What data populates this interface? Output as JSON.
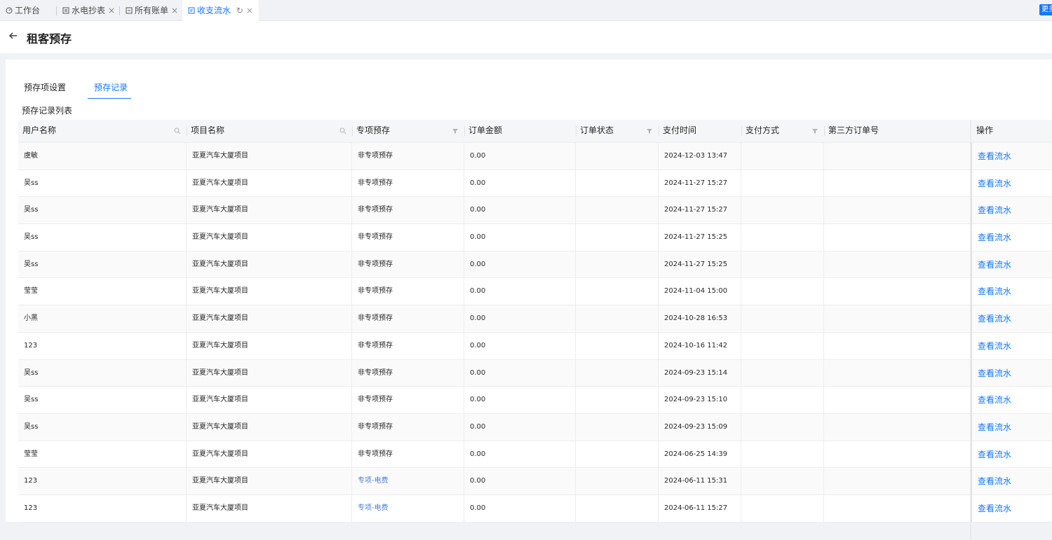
{
  "tabs": [
    {
      "icon": "dashboard-icon",
      "label": "工作台",
      "closable": false
    },
    {
      "icon": "meter-icon",
      "label": "水电抄表",
      "closable": true
    },
    {
      "icon": "bill-icon",
      "label": "所有账单",
      "closable": true
    },
    {
      "icon": "ledger-icon",
      "label": "收支流水",
      "closable": true,
      "active": true
    }
  ],
  "more_button": "更多",
  "page": {
    "title": "租客预存"
  },
  "subtabs": [
    "预存项设置",
    "预存记录"
  ],
  "active_subtab": "预存记录",
  "section_title": "预存记录列表",
  "table": {
    "headers": [
      "用户名称",
      "项目名称",
      "专项预存",
      "订单金额",
      "订单状态",
      "支付时间",
      "支付方式",
      "第三方订单号",
      "操作"
    ],
    "action_label": "查看流水",
    "rows": [
      {
        "user": "虞敏",
        "project": "亚夏汽车大厦项目",
        "type": "非专项预存",
        "amount": "0.00",
        "status": "",
        "time": "2024-12-03 13:47",
        "method": "",
        "order_no": ""
      },
      {
        "user": "吴ss",
        "project": "亚夏汽车大厦项目",
        "type": "非专项预存",
        "amount": "0.00",
        "status": "",
        "time": "2024-11-27 15:27",
        "method": "",
        "order_no": ""
      },
      {
        "user": "吴ss",
        "project": "亚夏汽车大厦项目",
        "type": "非专项预存",
        "amount": "0.00",
        "status": "",
        "time": "2024-11-27 15:27",
        "method": "",
        "order_no": ""
      },
      {
        "user": "吴ss",
        "project": "亚夏汽车大厦项目",
        "type": "非专项预存",
        "amount": "0.00",
        "status": "",
        "time": "2024-11-27 15:25",
        "method": "",
        "order_no": ""
      },
      {
        "user": "吴ss",
        "project": "亚夏汽车大厦项目",
        "type": "非专项预存",
        "amount": "0.00",
        "status": "",
        "time": "2024-11-27 15:25",
        "method": "",
        "order_no": ""
      },
      {
        "user": "莹莹",
        "project": "亚夏汽车大厦项目",
        "type": "非专项预存",
        "amount": "0.00",
        "status": "",
        "time": "2024-11-04 15:00",
        "method": "",
        "order_no": ""
      },
      {
        "user": "小黑",
        "project": "亚夏汽车大厦项目",
        "type": "非专项预存",
        "amount": "0.00",
        "status": "",
        "time": "2024-10-28 16:53",
        "method": "",
        "order_no": ""
      },
      {
        "user": "123",
        "project": "亚夏汽车大厦项目",
        "type": "非专项预存",
        "amount": "0.00",
        "status": "",
        "time": "2024-10-16 11:42",
        "method": "",
        "order_no": ""
      },
      {
        "user": "吴ss",
        "project": "亚夏汽车大厦项目",
        "type": "非专项预存",
        "amount": "0.00",
        "status": "",
        "time": "2024-09-23 15:14",
        "method": "",
        "order_no": ""
      },
      {
        "user": "吴ss",
        "project": "亚夏汽车大厦项目",
        "type": "非专项预存",
        "amount": "0.00",
        "status": "",
        "time": "2024-09-23 15:10",
        "method": "",
        "order_no": ""
      },
      {
        "user": "吴ss",
        "project": "亚夏汽车大厦项目",
        "type": "非专项预存",
        "amount": "0.00",
        "status": "",
        "time": "2024-09-23 15:09",
        "method": "",
        "order_no": ""
      },
      {
        "user": "莹莹",
        "project": "亚夏汽车大厦项目",
        "type": "非专项预存",
        "amount": "0.00",
        "status": "",
        "time": "2024-06-25 14:39",
        "method": "",
        "order_no": ""
      },
      {
        "user": "123",
        "project": "亚夏汽车大厦项目",
        "type": "专项-电费",
        "amount": "0.00",
        "status": "",
        "time": "2024-06-11 15:31",
        "method": "",
        "order_no": ""
      },
      {
        "user": "123",
        "project": "亚夏汽车大厦项目",
        "type": "专项-电费",
        "amount": "0.00",
        "status": "",
        "time": "2024-06-11 15:27",
        "method": "",
        "order_no": ""
      }
    ]
  },
  "colors": {
    "accent": "#1677ff",
    "special_type": "#4e7fd6"
  }
}
